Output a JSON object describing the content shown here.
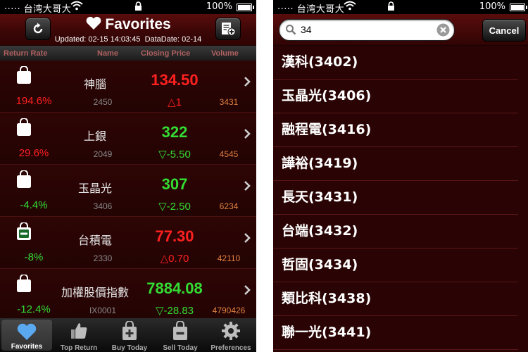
{
  "left": {
    "status": {
      "carrier": "····· 台湾大哥大",
      "battery": "100%"
    },
    "nav": {
      "title": "Favorites",
      "updated": "Updated: 02-15 14:03:45",
      "datadate": "DataDate: 02-14"
    },
    "columns": {
      "return_rate": "Return Rate",
      "name": "Name",
      "closing_price": "Closing Price",
      "volume": "Volume"
    },
    "rows": [
      {
        "name": "神腦",
        "code": "2450",
        "price": "134.50",
        "change": "△1",
        "return_rate": "194.6%",
        "volume": "3431",
        "price_color": "red",
        "return_color": "red",
        "bag_icon": "shopping-bag-icon"
      },
      {
        "name": "上銀",
        "code": "2049",
        "price": "322",
        "change": "▽-5.50",
        "return_rate": "29.6%",
        "volume": "4545",
        "price_color": "green",
        "return_color": "red",
        "bag_icon": "shopping-bag-icon"
      },
      {
        "name": "玉晶光",
        "code": "3406",
        "price": "307",
        "change": "▽-2.50",
        "return_rate": "-4.4%",
        "volume": "6234",
        "price_color": "green",
        "return_color": "green",
        "bag_icon": "shopping-bag-icon"
      },
      {
        "name": "台積電",
        "code": "2330",
        "price": "77.30",
        "change": "△0.70",
        "return_rate": "-8%",
        "volume": "42110",
        "price_color": "red",
        "return_color": "green",
        "bag_icon": "shopping-bag-minus-icon"
      },
      {
        "name": "加權股價指數",
        "code": "IX0001",
        "price": "7884.08",
        "change": "▽-28.83",
        "return_rate": "-12.4%",
        "volume": "4790426",
        "price_color": "green",
        "return_color": "green",
        "bag_icon": "shopping-bag-icon"
      }
    ],
    "tabs": [
      {
        "label": "Favorites",
        "icon": "heart-icon",
        "active": true
      },
      {
        "label": "Top Return",
        "icon": "thumbs-up-icon",
        "active": false
      },
      {
        "label": "Buy Today",
        "icon": "bag-plus-icon",
        "active": false
      },
      {
        "label": "Sell Today",
        "icon": "bag-minus-icon",
        "active": false
      },
      {
        "label": "Preferences",
        "icon": "gear-icon",
        "active": false
      }
    ]
  },
  "right": {
    "status": {
      "carrier": "····· 台湾大哥大",
      "battery": "100%"
    },
    "search": {
      "value": "34",
      "placeholder": "",
      "cancel_label": "Cancel"
    },
    "results": [
      "漢科(3402)",
      "玉晶光(3406)",
      "融程電(3416)",
      "譁裕(3419)",
      "長天(3431)",
      "台端(3432)",
      "哲固(3434)",
      "類比科(3438)",
      "聯一光(3441)"
    ]
  },
  "colors": {
    "price_red": "#ff2020",
    "price_green": "#33dd33",
    "volume_orange": "#e08040",
    "background": "#2a0404"
  }
}
